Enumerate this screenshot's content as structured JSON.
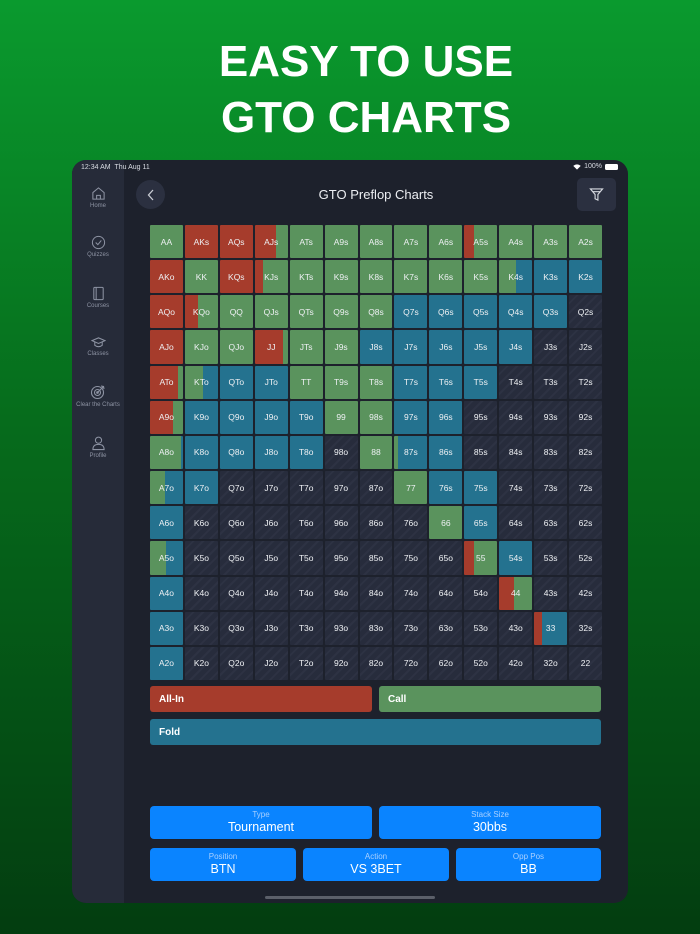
{
  "headline": [
    "EASY TO USE",
    "GTO CHARTS"
  ],
  "status": {
    "time": "12:34 AM",
    "date": "Thu Aug 11",
    "battery": "100%"
  },
  "sidebar": [
    {
      "label": "Home",
      "icon": "home-icon"
    },
    {
      "label": "Quizzes",
      "icon": "check-circle-icon"
    },
    {
      "label": "Courses",
      "icon": "book-icon"
    },
    {
      "label": "Classes",
      "icon": "graduation-cap-icon"
    },
    {
      "label": "Clear the Charts",
      "icon": "target-icon"
    },
    {
      "label": "Profile",
      "icon": "person-icon"
    }
  ],
  "header": {
    "title": "GTO Preflop Charts"
  },
  "colors": {
    "allin": "#a63c2c",
    "call": "#5a935d",
    "fold": "#24728f"
  },
  "grid": [
    [
      [
        "AA",
        0,
        1,
        0
      ],
      [
        "AKs",
        1,
        0,
        0
      ],
      [
        "AQs",
        1,
        0,
        0
      ],
      [
        "AJs",
        0.65,
        0.35,
        0
      ],
      [
        "ATs",
        0,
        1,
        0
      ],
      [
        "A9s",
        0,
        1,
        0
      ],
      [
        "A8s",
        0,
        1,
        0
      ],
      [
        "A7s",
        0,
        1,
        0
      ],
      [
        "A6s",
        0,
        1,
        0
      ],
      [
        "A5s",
        0.28,
        0.72,
        0
      ],
      [
        "A4s",
        0,
        1,
        0
      ],
      [
        "A3s",
        0,
        1,
        0
      ],
      [
        "A2s",
        0,
        1,
        0
      ]
    ],
    [
      [
        "AKo",
        1,
        0,
        0
      ],
      [
        "KK",
        0,
        1,
        0
      ],
      [
        "KQs",
        1,
        0,
        0
      ],
      [
        "KJs",
        0.25,
        0.75,
        0
      ],
      [
        "KTs",
        0,
        1,
        0
      ],
      [
        "K9s",
        0,
        1,
        0
      ],
      [
        "K8s",
        0,
        1,
        0
      ],
      [
        "K7s",
        0,
        1,
        0
      ],
      [
        "K6s",
        0,
        1,
        0
      ],
      [
        "K5s",
        0,
        1,
        0
      ],
      [
        "K4s",
        0,
        0.5,
        0.5
      ],
      [
        "K3s",
        0,
        0,
        1
      ],
      [
        "K2s",
        0,
        0,
        1
      ]
    ],
    [
      [
        "AQo",
        1,
        0,
        0
      ],
      [
        "KQo",
        0.4,
        0.6,
        0
      ],
      [
        "QQ",
        0,
        1,
        0
      ],
      [
        "QJs",
        0,
        1,
        0
      ],
      [
        "QTs",
        0,
        1,
        0
      ],
      [
        "Q9s",
        0,
        1,
        0
      ],
      [
        "Q8s",
        0,
        1,
        0
      ],
      [
        "Q7s",
        0,
        0,
        1
      ],
      [
        "Q6s",
        0,
        0,
        1
      ],
      [
        "Q5s",
        0,
        0,
        1
      ],
      [
        "Q4s",
        0,
        0,
        1
      ],
      [
        "Q3s",
        0,
        0,
        1
      ],
      [
        "Q2s",
        0,
        0,
        0
      ]
    ],
    [
      [
        "AJo",
        1,
        0,
        0
      ],
      [
        "KJo",
        0,
        1,
        0
      ],
      [
        "QJo",
        0,
        1,
        0
      ],
      [
        "JJ",
        0.85,
        0.15,
        0
      ],
      [
        "JTs",
        0,
        1,
        0
      ],
      [
        "J9s",
        0,
        1,
        0
      ],
      [
        "J8s",
        0,
        0,
        1
      ],
      [
        "J7s",
        0,
        0,
        1
      ],
      [
        "J6s",
        0,
        0,
        1
      ],
      [
        "J5s",
        0,
        0,
        1
      ],
      [
        "J4s",
        0,
        0,
        1
      ],
      [
        "J3s",
        0,
        0,
        0
      ],
      [
        "J2s",
        0,
        0,
        0
      ]
    ],
    [
      [
        "ATo",
        0.85,
        0.15,
        0
      ],
      [
        "KTo",
        0,
        0.55,
        0.45
      ],
      [
        "QTo",
        0,
        0,
        1
      ],
      [
        "JTo",
        0,
        0,
        1
      ],
      [
        "TT",
        0,
        1,
        0
      ],
      [
        "T9s",
        0,
        1,
        0
      ],
      [
        "T8s",
        0,
        1,
        0
      ],
      [
        "T7s",
        0,
        0,
        1
      ],
      [
        "T6s",
        0,
        0,
        1
      ],
      [
        "T5s",
        0,
        0,
        1
      ],
      [
        "T4s",
        0,
        0,
        0
      ],
      [
        "T3s",
        0,
        0,
        0
      ],
      [
        "T2s",
        0,
        0,
        0
      ]
    ],
    [
      [
        "A9o",
        0.7,
        0.3,
        0
      ],
      [
        "K9o",
        0,
        0,
        1
      ],
      [
        "Q9o",
        0,
        0,
        1
      ],
      [
        "J9o",
        0,
        0,
        1
      ],
      [
        "T9o",
        0,
        0,
        1
      ],
      [
        "99",
        0,
        1,
        0
      ],
      [
        "98s",
        0,
        1,
        0
      ],
      [
        "97s",
        0,
        0,
        1
      ],
      [
        "96s",
        0,
        0,
        1
      ],
      [
        "95s",
        0,
        0,
        0
      ],
      [
        "94s",
        0,
        0,
        0
      ],
      [
        "93s",
        0,
        0,
        0
      ],
      [
        "92s",
        0,
        0,
        0
      ]
    ],
    [
      [
        "A8o",
        0,
        0.95,
        0.05
      ],
      [
        "K8o",
        0,
        0,
        1
      ],
      [
        "Q8o",
        0,
        0,
        1
      ],
      [
        "J8o",
        0,
        0,
        1
      ],
      [
        "T8o",
        0,
        0,
        1
      ],
      [
        "98o",
        0,
        0,
        0
      ],
      [
        "88",
        0,
        1,
        0
      ],
      [
        "87s",
        0,
        0.1,
        0.9
      ],
      [
        "86s",
        0,
        0,
        1
      ],
      [
        "85s",
        0,
        0,
        0
      ],
      [
        "84s",
        0,
        0,
        0
      ],
      [
        "83s",
        0,
        0,
        0
      ],
      [
        "82s",
        0,
        0,
        0
      ]
    ],
    [
      [
        "A7o",
        0,
        0.45,
        0.55
      ],
      [
        "K7o",
        0,
        0,
        1
      ],
      [
        "Q7o",
        0,
        0,
        0
      ],
      [
        "J7o",
        0,
        0,
        0
      ],
      [
        "T7o",
        0,
        0,
        0
      ],
      [
        "97o",
        0,
        0,
        0
      ],
      [
        "87o",
        0,
        0,
        0
      ],
      [
        "77",
        0,
        1,
        0
      ],
      [
        "76s",
        0,
        0,
        1
      ],
      [
        "75s",
        0,
        0,
        1
      ],
      [
        "74s",
        0,
        0,
        0
      ],
      [
        "73s",
        0,
        0,
        0
      ],
      [
        "72s",
        0,
        0,
        0
      ]
    ],
    [
      [
        "A6o",
        0,
        0,
        1
      ],
      [
        "K6o",
        0,
        0,
        0
      ],
      [
        "Q6o",
        0,
        0,
        0
      ],
      [
        "J6o",
        0,
        0,
        0
      ],
      [
        "T6o",
        0,
        0,
        0
      ],
      [
        "96o",
        0,
        0,
        0
      ],
      [
        "86o",
        0,
        0,
        0
      ],
      [
        "76o",
        0,
        0,
        0
      ],
      [
        "66",
        0,
        1,
        0
      ],
      [
        "65s",
        0,
        0,
        1
      ],
      [
        "64s",
        0,
        0,
        0
      ],
      [
        "63s",
        0,
        0,
        0
      ],
      [
        "62s",
        0,
        0,
        0
      ]
    ],
    [
      [
        "A5o",
        0,
        0.5,
        0.5
      ],
      [
        "K5o",
        0,
        0,
        0
      ],
      [
        "Q5o",
        0,
        0,
        0
      ],
      [
        "J5o",
        0,
        0,
        0
      ],
      [
        "T5o",
        0,
        0,
        0
      ],
      [
        "95o",
        0,
        0,
        0
      ],
      [
        "85o",
        0,
        0,
        0
      ],
      [
        "75o",
        0,
        0,
        0
      ],
      [
        "65o",
        0,
        0,
        0
      ],
      [
        "55",
        0.3,
        0.7,
        0
      ],
      [
        "54s",
        0,
        0,
        1
      ],
      [
        "53s",
        0,
        0,
        0
      ],
      [
        "52s",
        0,
        0,
        0
      ]
    ],
    [
      [
        "A4o",
        0,
        0,
        1
      ],
      [
        "K4o",
        0,
        0,
        0
      ],
      [
        "Q4o",
        0,
        0,
        0
      ],
      [
        "J4o",
        0,
        0,
        0
      ],
      [
        "T4o",
        0,
        0,
        0
      ],
      [
        "94o",
        0,
        0,
        0
      ],
      [
        "84o",
        0,
        0,
        0
      ],
      [
        "74o",
        0,
        0,
        0
      ],
      [
        "64o",
        0,
        0,
        0
      ],
      [
        "54o",
        0,
        0,
        0
      ],
      [
        "44",
        0.45,
        0.55,
        0
      ],
      [
        "43s",
        0,
        0,
        0
      ],
      [
        "42s",
        0,
        0,
        0
      ]
    ],
    [
      [
        "A3o",
        0,
        0,
        1
      ],
      [
        "K3o",
        0,
        0,
        0
      ],
      [
        "Q3o",
        0,
        0,
        0
      ],
      [
        "J3o",
        0,
        0,
        0
      ],
      [
        "T3o",
        0,
        0,
        0
      ],
      [
        "93o",
        0,
        0,
        0
      ],
      [
        "83o",
        0,
        0,
        0
      ],
      [
        "73o",
        0,
        0,
        0
      ],
      [
        "63o",
        0,
        0,
        0
      ],
      [
        "53o",
        0,
        0,
        0
      ],
      [
        "43o",
        0,
        0,
        0
      ],
      [
        "33",
        0.25,
        0,
        0.75
      ],
      [
        "32s",
        0,
        0,
        0
      ]
    ],
    [
      [
        "A2o",
        0,
        0,
        1
      ],
      [
        "K2o",
        0,
        0,
        0
      ],
      [
        "Q2o",
        0,
        0,
        0
      ],
      [
        "J2o",
        0,
        0,
        0
      ],
      [
        "T2o",
        0,
        0,
        0
      ],
      [
        "92o",
        0,
        0,
        0
      ],
      [
        "82o",
        0,
        0,
        0
      ],
      [
        "72o",
        0,
        0,
        0
      ],
      [
        "62o",
        0,
        0,
        0
      ],
      [
        "52o",
        0,
        0,
        0
      ],
      [
        "42o",
        0,
        0,
        0
      ],
      [
        "32o",
        0,
        0,
        0
      ],
      [
        "22",
        0,
        0,
        0
      ]
    ]
  ],
  "legend": {
    "allin": "All-In",
    "call": "Call",
    "fold": "Fold"
  },
  "options": {
    "type": {
      "label": "Type",
      "value": "Tournament"
    },
    "stack": {
      "label": "Stack Size",
      "value": "30bbs"
    },
    "position": {
      "label": "Position",
      "value": "BTN"
    },
    "action": {
      "label": "Action",
      "value": "VS 3BET"
    },
    "opp": {
      "label": "Opp Pos",
      "value": "BB"
    }
  }
}
